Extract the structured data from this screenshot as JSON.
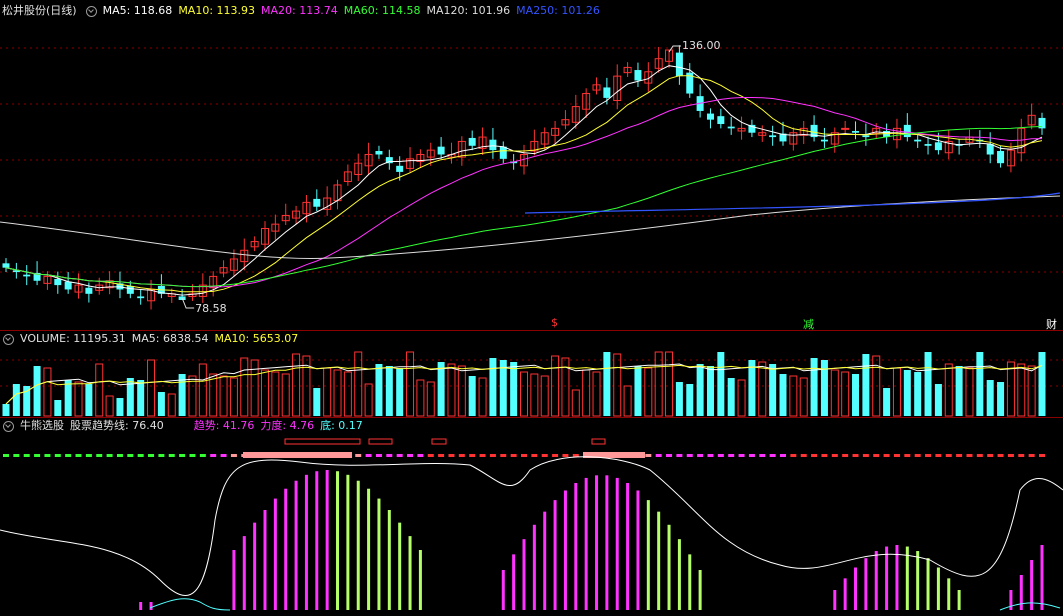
{
  "main": {
    "title": "松井股份(日线)",
    "ma": [
      {
        "label": "MA5: 118.68",
        "color": "#ffffff"
      },
      {
        "label": "MA10: 113.93",
        "color": "#ffff33"
      },
      {
        "label": "MA20: 113.74",
        "color": "#ff33ff"
      },
      {
        "label": "MA60: 114.58",
        "color": "#33ff33"
      },
      {
        "label": "MA120: 101.96",
        "color": "#dddddd"
      },
      {
        "label": "MA250: 101.26",
        "color": "#3355ff"
      }
    ],
    "high_label": "136.00",
    "low_label": "78.58",
    "markers": [
      {
        "text": "$",
        "color": "#ff3333"
      },
      {
        "text": "减",
        "color": "#33ff33"
      },
      {
        "text": "财",
        "color": "#ffffff"
      }
    ]
  },
  "volume": {
    "title": "VOLUME: 11195.31",
    "ma5": "MA5: 6838.54",
    "ma10": "MA10: 5653.07"
  },
  "indicator": {
    "title": "牛熊选股",
    "trend_line": "股票趋势线: 76.40",
    "qushi": "趋势: 41.76",
    "lidu": "力度: 4.76",
    "di": "底: 0.17"
  },
  "colors": {
    "up": "#ff3333",
    "down": "#54ffff",
    "bg": "#000000",
    "grid": "#8b0000"
  },
  "chart_data": {
    "type": "candlestick",
    "candles_close_approx": [
      86,
      85,
      84,
      83,
      84,
      82,
      81,
      82,
      80,
      82,
      83,
      81,
      80,
      79,
      81,
      80,
      80,
      78.58,
      80,
      82,
      84,
      86,
      88,
      90,
      92,
      95,
      96,
      98,
      99,
      101,
      100,
      102,
      105,
      108,
      110,
      112,
      112,
      110,
      108,
      111,
      112,
      113,
      112,
      112,
      115,
      114,
      116,
      113,
      111,
      110,
      112,
      115,
      117,
      118,
      120,
      123,
      126,
      128,
      125,
      130,
      132,
      129,
      131,
      134,
      136,
      130,
      126,
      122,
      120,
      119,
      118,
      118,
      117,
      117,
      116,
      115,
      117,
      118,
      116,
      115,
      117,
      118,
      117,
      116,
      118,
      116,
      118,
      116,
      115,
      114,
      113,
      115,
      114,
      116,
      115,
      112,
      110,
      113,
      118,
      121,
      118
    ],
    "ylim": [
      78.58,
      136
    ]
  }
}
